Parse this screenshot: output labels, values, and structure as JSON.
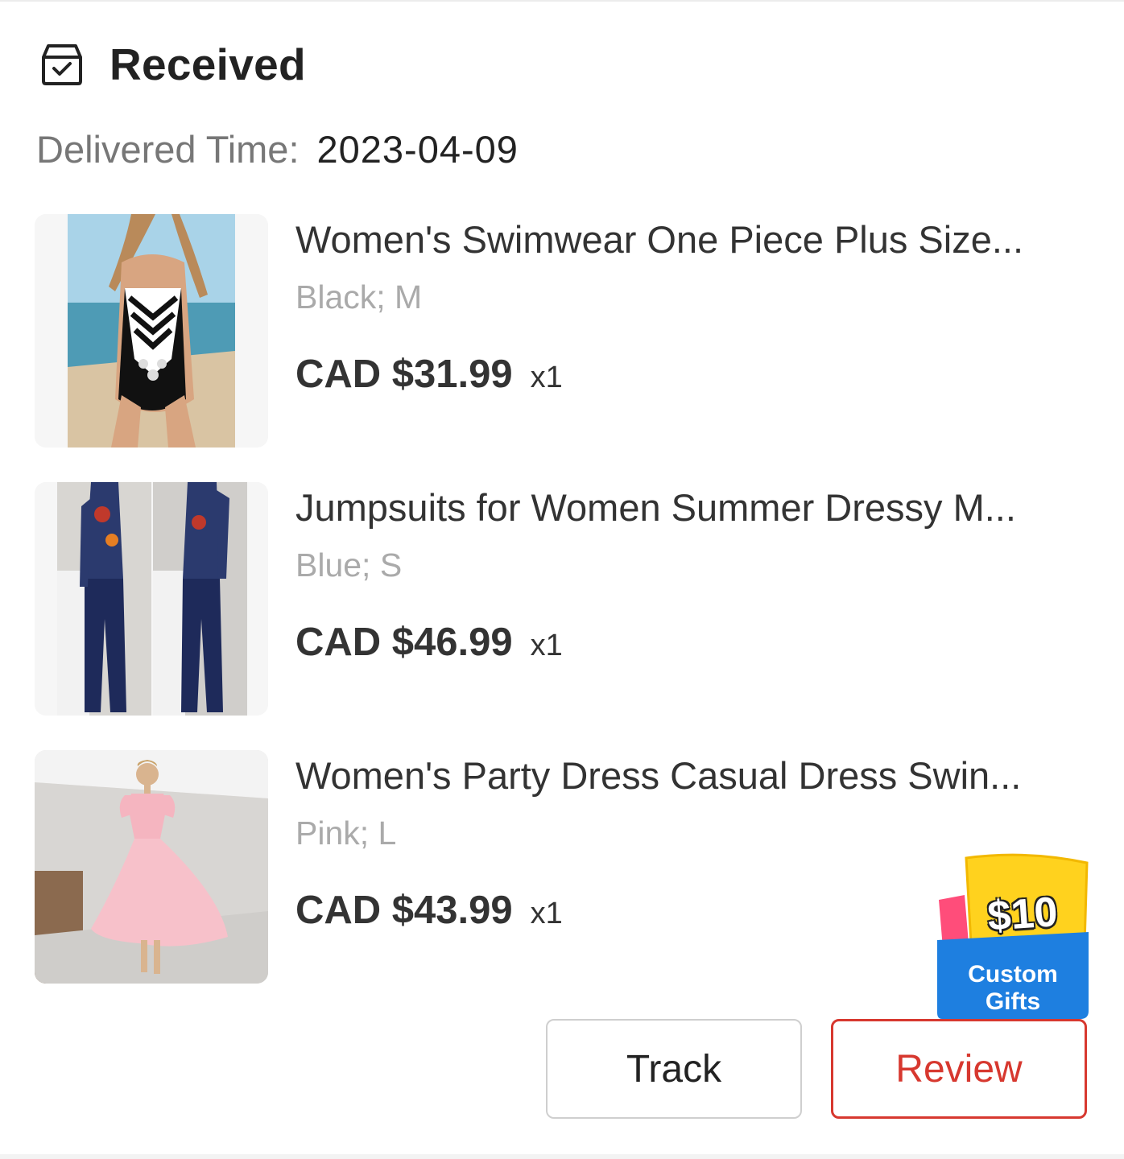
{
  "status": {
    "title": "Received",
    "icon": "received-box-check-icon"
  },
  "delivered": {
    "label": "Delivered Time:",
    "value": "2023-04-09"
  },
  "items": [
    {
      "title": "Women's Swimwear One Piece Plus Size...",
      "variant": "Black; M",
      "price": "CAD $31.99",
      "qty": "x1"
    },
    {
      "title": "Jumpsuits for Women Summer Dressy M...",
      "variant": "Blue; S",
      "price": "CAD $46.99",
      "qty": "x1"
    },
    {
      "title": "Women's Party Dress Casual Dress Swin...",
      "variant": "Pink; L",
      "price": "CAD $43.99",
      "qty": "x1"
    }
  ],
  "gift_badge": {
    "amount": "$10",
    "label_line1": "Custom",
    "label_line2": "Gifts"
  },
  "actions": {
    "track_label": "Track",
    "review_label": "Review"
  },
  "colors": {
    "accent_red": "#d7382f",
    "gift_yellow": "#ffd21e",
    "gift_blue": "#1e7fe0",
    "gift_pink": "#ff4d7a"
  }
}
